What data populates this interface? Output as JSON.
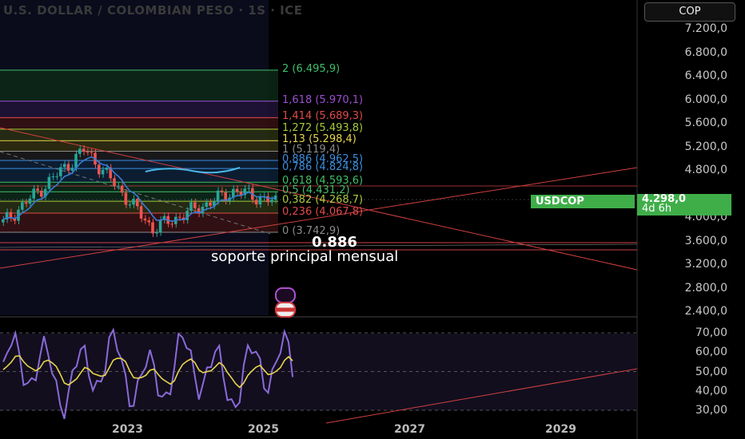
{
  "header": {
    "title": "U.S. DOLLAR / COLOMBIAN PESO · 1S · ICE"
  },
  "currency_button": {
    "label": "COP"
  },
  "price_axis": {
    "ticks": [
      "7.200,0",
      "6.800,0",
      "6.400,0",
      "6.000,0",
      "5.600,0",
      "5.200,0",
      "4.800,0",
      "4.000,0",
      "3.600,0",
      "3.200,0",
      "2.800,0",
      "2.400,0"
    ],
    "tick_values": [
      7200,
      6800,
      6400,
      6000,
      5600,
      5200,
      4800,
      4000,
      3600,
      3200,
      2800,
      2400
    ]
  },
  "rsi_axis": {
    "ticks": [
      "70,00",
      "60,00",
      "50,00",
      "40,00",
      "30,00"
    ],
    "tick_values": [
      70,
      60,
      50,
      40,
      30
    ]
  },
  "time_axis": {
    "labels": [
      "2023",
      "2025",
      "2027",
      "2029"
    ]
  },
  "symbol_tag": {
    "label": "USDCOP"
  },
  "last_price": {
    "value": "4.298,0",
    "countdown": "4d 6h"
  },
  "fib_levels": [
    {
      "text": "2 (6.495,9)",
      "price": 6495.9,
      "color": "#3fbf6a"
    },
    {
      "text": "1,618 (5.970,1)",
      "price": 5970.1,
      "color": "#9b4fd1"
    },
    {
      "text": "1,414 (5.689,3)",
      "price": 5689.3,
      "color": "#e04a4a"
    },
    {
      "text": "1,272 (5.493,8)",
      "price": 5493.8,
      "color": "#a8c93a"
    },
    {
      "text": "1,13 (5.298,4)",
      "price": 5298.4,
      "color": "#e6d84a"
    },
    {
      "text": "1 (5.119,4)",
      "price": 5119.4,
      "color": "#8a8a8a"
    },
    {
      "text": "0,886 (4.962,5)",
      "price": 4962.5,
      "color": "#3a8fe0"
    },
    {
      "text": "0,786 (4.824,8)",
      "price": 4824.8,
      "color": "#3a8fe0"
    },
    {
      "text": "0,618 (4.593,6)",
      "price": 4593.6,
      "color": "#3fbf6a"
    },
    {
      "text": "0,5 (4.431,2)",
      "price": 4431.2,
      "color": "#3fbf6a"
    },
    {
      "text": "0,382 (4.268,7)",
      "price": 4268.7,
      "color": "#a8c93a"
    },
    {
      "text": "0,236 (4.067,8)",
      "price": 4067.8,
      "color": "#e04a4a"
    },
    {
      "text": "0 (3.742,9)",
      "price": 3742.9,
      "color": "#8a8a8a"
    }
  ],
  "annotations": {
    "level": "0.886",
    "note": "soporte principal mensual"
  },
  "colors": {
    "bull": "#26a69a",
    "bear": "#ef5350",
    "ema": "#3a7bd5",
    "rsi": "#8a6ad8",
    "rsi_ma": "#e8d44d",
    "tag": "#3fae49"
  },
  "icons": {
    "event_1": "lightning-icon",
    "event_2": "us-flag-icon"
  }
}
